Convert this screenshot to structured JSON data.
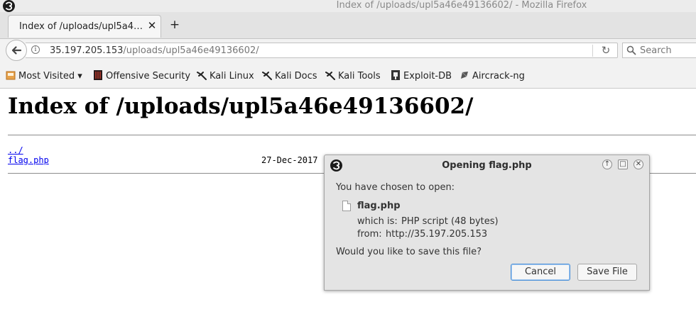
{
  "window": {
    "title": "Index of /uploads/upl5a46e49136602/ - Mozilla Firefox"
  },
  "tabs": [
    {
      "label": "Index of /uploads/upl5a4…",
      "close": "✕"
    }
  ],
  "new_tab": "+",
  "navbar": {
    "url_host": "35.197.205.153",
    "url_path": "/uploads/upl5a46e49136602/",
    "search_placeholder": "Search"
  },
  "bookmarks": [
    {
      "label": "Most Visited ▾",
      "icon": "most-visited-icon"
    },
    {
      "label": "Offensive Security",
      "icon": "offensive-security-icon"
    },
    {
      "label": "Kali Linux",
      "icon": "kali-dragon-icon"
    },
    {
      "label": "Kali Docs",
      "icon": "kali-dragon-icon"
    },
    {
      "label": "Kali Tools",
      "icon": "kali-dragon-icon"
    },
    {
      "label": "Exploit-DB",
      "icon": "exploit-db-icon"
    },
    {
      "label": "Aircrack-ng",
      "icon": "aircrack-icon"
    }
  ],
  "page": {
    "heading": "Index of /uploads/upl5a46e49136602/",
    "entries": [
      {
        "name": "../",
        "date": ""
      },
      {
        "name": "flag.php",
        "date": "27-Dec-2017 1"
      }
    ]
  },
  "dialog": {
    "title": "Opening flag.php",
    "intro": "You have chosen to open:",
    "filename": "flag.php",
    "which_is_label": "which is:",
    "which_is_value": "PHP script (48 bytes)",
    "from_label": "from:",
    "from_value": "http://35.197.205.153",
    "question": "Would you like to save this file?",
    "cancel_label": "Cancel",
    "save_label": "Save File"
  },
  "colors": {
    "link": "#0000ee",
    "default_button_border": "#4a90d9"
  }
}
